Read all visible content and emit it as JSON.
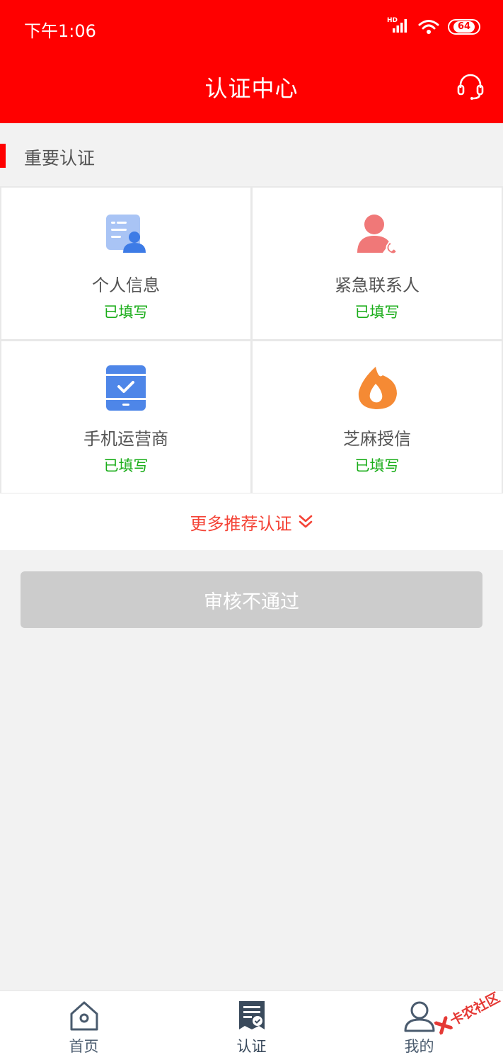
{
  "status_bar": {
    "time": "下午1:06",
    "network": "HD",
    "battery": "64"
  },
  "header": {
    "title": "认证中心"
  },
  "section": {
    "title": "重要认证"
  },
  "cards": [
    {
      "name": "个人信息",
      "status": "已填写",
      "icon": "id-card-person-icon"
    },
    {
      "name": "紧急联系人",
      "status": "已填写",
      "icon": "contact-phone-icon"
    },
    {
      "name": "手机运营商",
      "status": "已填写",
      "icon": "phone-check-icon"
    },
    {
      "name": "芝麻授信",
      "status": "已填写",
      "icon": "sesame-drop-icon"
    }
  ],
  "more": {
    "label": "更多推荐认证"
  },
  "submit": {
    "label": "审核不通过"
  },
  "tabs": [
    {
      "label": "首页",
      "icon": "home-icon"
    },
    {
      "label": "认证",
      "icon": "certificate-icon"
    },
    {
      "label": "我的",
      "icon": "user-icon"
    }
  ],
  "watermark": {
    "text": "卡农社区"
  },
  "colors": {
    "brand": "#ff0000",
    "success": "#1aad19",
    "link": "#f44336",
    "disabled": "#cccccc"
  }
}
